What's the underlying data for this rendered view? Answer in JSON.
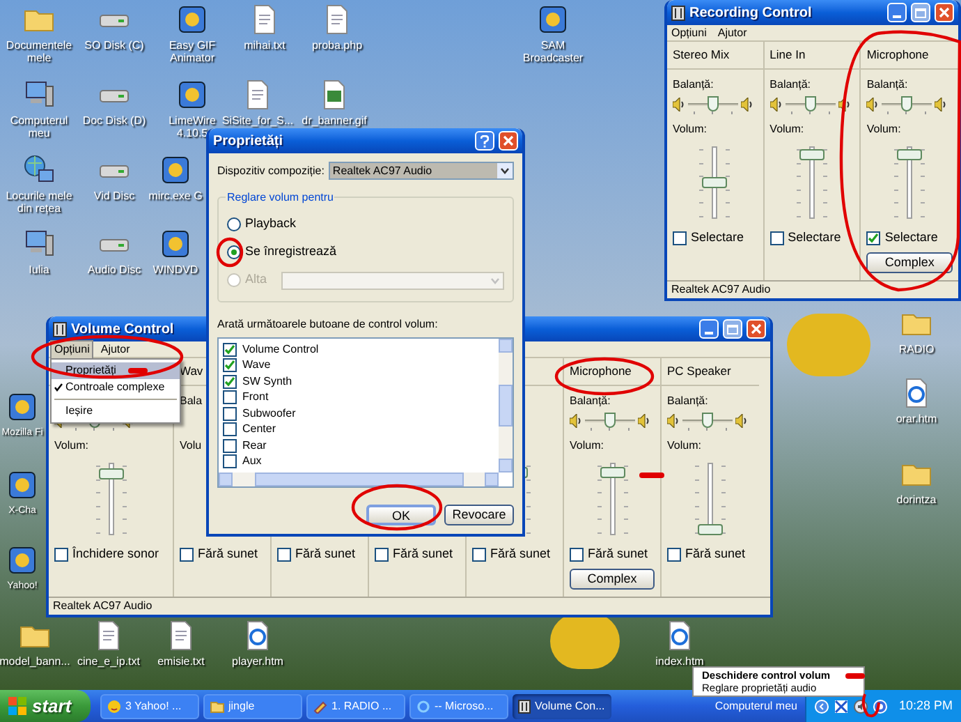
{
  "desktop_icons": [
    {
      "label": "Documentele mele",
      "kind": "folder"
    },
    {
      "label": "SO Disk (C)",
      "kind": "drive"
    },
    {
      "label": "Easy GIF Animator",
      "kind": "app"
    },
    {
      "label": "mihai.txt",
      "kind": "document"
    },
    {
      "label": "proba.php",
      "kind": "document"
    },
    {
      "label": "SAM Broadcaster",
      "kind": "app"
    },
    {
      "label": "Computerul meu",
      "kind": "computer"
    },
    {
      "label": "Doc Disk (D)",
      "kind": "drive"
    },
    {
      "label": "LimeWire 4.10.5",
      "kind": "app"
    },
    {
      "label": "SiSite_for_S...",
      "kind": "document"
    },
    {
      "label": "dr_banner.gif",
      "kind": "image"
    },
    {
      "label": "Locurile mele din rețea",
      "kind": "network"
    },
    {
      "label": "Vid Disc",
      "kind": "drive"
    },
    {
      "label": "mirc.exe G",
      "kind": "app"
    },
    {
      "label": "Iulia",
      "kind": "computer"
    },
    {
      "label": "Audio Disc",
      "kind": "drive"
    },
    {
      "label": "WINDVD",
      "kind": "app"
    },
    {
      "label": "Mozilla Fi",
      "kind": "app"
    },
    {
      "label": "X-Cha",
      "kind": "app"
    },
    {
      "label": "Yahoo!",
      "kind": "app"
    },
    {
      "label": "model_bann...",
      "kind": "folder"
    },
    {
      "label": "cine_e_ip.txt",
      "kind": "document"
    },
    {
      "label": "emisie.txt",
      "kind": "document"
    },
    {
      "label": "player.htm",
      "kind": "web"
    },
    {
      "label": "index.htm",
      "kind": "web"
    },
    {
      "label": "RADIO",
      "kind": "folder"
    },
    {
      "label": "orar.htm",
      "kind": "web"
    },
    {
      "label": "dorintza",
      "kind": "folder"
    }
  ],
  "recording_window": {
    "title": "Recording Control",
    "menu": [
      "Opțiuni",
      "Ajutor"
    ],
    "columns": [
      {
        "name": "Stereo Mix",
        "balance_label": "Balanță:",
        "balance": {
          "level": 0.5
        },
        "volume_label": "Volum:",
        "volume": {
          "level": 0.5
        },
        "checkbox": {
          "label": "Selectare",
          "checked": false
        }
      },
      {
        "name": "Line In",
        "balance_label": "Balanță:",
        "balance": {
          "level": 0.5
        },
        "volume_label": "Volum:",
        "volume": {
          "level": 0.92
        },
        "checkbox": {
          "label": "Selectare",
          "checked": false
        }
      },
      {
        "name": "Microphone",
        "balance_label": "Balanță:",
        "balance": {
          "level": 0.5
        },
        "volume_label": "Volum:",
        "volume": {
          "level": 0.92
        },
        "checkbox": {
          "label": "Selectare",
          "checked": true
        },
        "button": "Complex"
      }
    ],
    "status": "Realtek AC97 Audio"
  },
  "volume_window": {
    "title": "Volume Control",
    "menu": [
      {
        "label": "Opțiuni",
        "selected": true
      },
      {
        "label": "Ajutor",
        "selected": false
      }
    ],
    "menu_dropdown": [
      {
        "kind": "item",
        "label": "Proprietăți",
        "selected": true,
        "checked": false
      },
      {
        "kind": "item",
        "label": "Controale complexe",
        "selected": false,
        "checked": true
      },
      {
        "kind": "separator"
      },
      {
        "kind": "item",
        "label": "Ieșire",
        "selected": false,
        "checked": false
      }
    ],
    "columns": [
      {
        "balance": {
          "level": 0.5
        },
        "volume_label": "Volum:",
        "volume": {
          "level": 0.88
        },
        "checkbox": {
          "label": "Închidere sonor",
          "checked": false
        }
      },
      {
        "name": "Wav",
        "balance_label": "Bala",
        "volume_label": "Volu",
        "checkbox": {
          "label": "Fără sunet",
          "checked": false
        }
      },
      {
        "checkbox": {
          "label": "Fără sunet",
          "checked": false
        }
      },
      {
        "checkbox": {
          "label": "Fără sunet",
          "checked": false
        }
      },
      {
        "volume": {
          "level": 0.9
        },
        "checkbox": {
          "label": "Fără sunet",
          "checked": false
        }
      },
      {
        "name": "Microphone",
        "balance_label": "Balanță:",
        "balance": {
          "level": 0.5
        },
        "volume_label": "Volum:",
        "volume": {
          "level": 0.9
        },
        "checkbox": {
          "label": "Fără sunet",
          "checked": false
        },
        "button": "Complex"
      },
      {
        "name": "PC Speaker",
        "balance_label": "Balanță:",
        "balance": {
          "level": 0.5
        },
        "volume_label": "Volum:",
        "volume": {
          "level": 0.04
        },
        "checkbox": {
          "label": "Fără sunet",
          "checked": false
        }
      }
    ],
    "status": "Realtek AC97 Audio"
  },
  "properties_dialog": {
    "title": "Proprietăți",
    "device_label": "Dispozitiv compoziție:",
    "device_value": "Realtek AC97 Audio",
    "group_label": "Reglare volum pentru",
    "radios": [
      {
        "label": "Playback",
        "selected": false,
        "disabled": false
      },
      {
        "label": "Se înregistrează",
        "selected": true,
        "disabled": false
      },
      {
        "label": "Alta",
        "selected": false,
        "disabled": true
      }
    ],
    "list_label": "Arată următoarele butoane de control volum:",
    "list_items": [
      {
        "label": "Volume Control",
        "checked": true
      },
      {
        "label": "Wave",
        "checked": true
      },
      {
        "label": "SW Synth",
        "checked": true
      },
      {
        "label": "Front",
        "checked": false
      },
      {
        "label": "Subwoofer",
        "checked": false
      },
      {
        "label": "Center",
        "checked": false
      },
      {
        "label": "Rear",
        "checked": false
      },
      {
        "label": "Aux",
        "checked": false
      }
    ],
    "buttons": [
      {
        "label": "OK",
        "default": true
      },
      {
        "label": "Revocare",
        "default": false
      }
    ]
  },
  "tray_menu": [
    {
      "label": "Deschidere control volum",
      "default": true
    },
    {
      "label": "Reglare proprietăți audio",
      "default": false
    }
  ],
  "taskbar": {
    "start": "start",
    "buttons": [
      {
        "label": "3 Yahoo! ...",
        "kind": "messenger",
        "selected": false
      },
      {
        "label": "jingle",
        "kind": "folder",
        "selected": false
      },
      {
        "label": "1. RADIO ...",
        "kind": "app",
        "selected": false
      },
      {
        "label": "-- Microso...",
        "kind": "browser",
        "selected": false
      },
      {
        "label": "Volume Con...",
        "kind": "mixer",
        "selected": true
      }
    ],
    "toolbar_label": "Computerul meu",
    "clock": "10:28 PM"
  }
}
